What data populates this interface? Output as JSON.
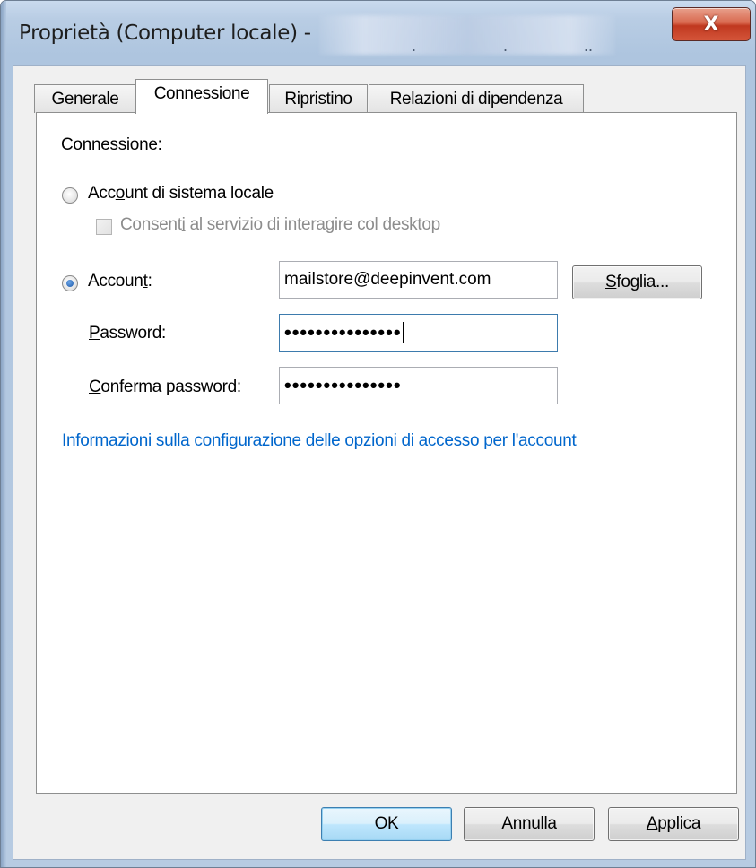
{
  "window": {
    "title": "Proprietà (Computer locale) -",
    "close_glyph": "X"
  },
  "tabs": [
    {
      "label": "Generale",
      "active": false
    },
    {
      "label": "Connessione",
      "active": true
    },
    {
      "label": "Ripristino",
      "active": false
    },
    {
      "label": "Relazioni di dipendenza",
      "active": false
    }
  ],
  "connection": {
    "section_label": "Connessione:",
    "local_account": {
      "label_pre": "Acc",
      "label_mn": "o",
      "label_post": "unt di sistema locale",
      "selected": false
    },
    "desktop_interact": {
      "label_pre": "Consent",
      "label_mn": "i",
      "label_post": " al servizio di interagire col desktop",
      "checked": false,
      "enabled": false
    },
    "account": {
      "label_pre": "Accoun",
      "label_mn": "t",
      "label_post": ":",
      "selected": true,
      "value": "mailstore@deepinvent.com",
      "browse_pre": "",
      "browse_mn": "S",
      "browse_post": "foglia..."
    },
    "password": {
      "label_pre": "",
      "label_mn": "P",
      "label_post": "assword:",
      "value": "•••••••••••••••"
    },
    "confirm_password": {
      "label_pre": "",
      "label_mn": "C",
      "label_post": "onferma password:",
      "value": "•••••••••••••••"
    },
    "help_link": "Informazioni sulla configurazione delle opzioni di accesso per l'account"
  },
  "buttons": {
    "ok": "OK",
    "cancel": "Annulla",
    "apply_pre": "",
    "apply_mn": "A",
    "apply_post": "pplica"
  },
  "icons": {
    "close": "close-icon",
    "radio": "radio-button",
    "checkbox": "checkbox"
  },
  "colors": {
    "link": "#0066cc",
    "close_button": "#c9412a",
    "default_button_border": "#3c7fb1"
  }
}
